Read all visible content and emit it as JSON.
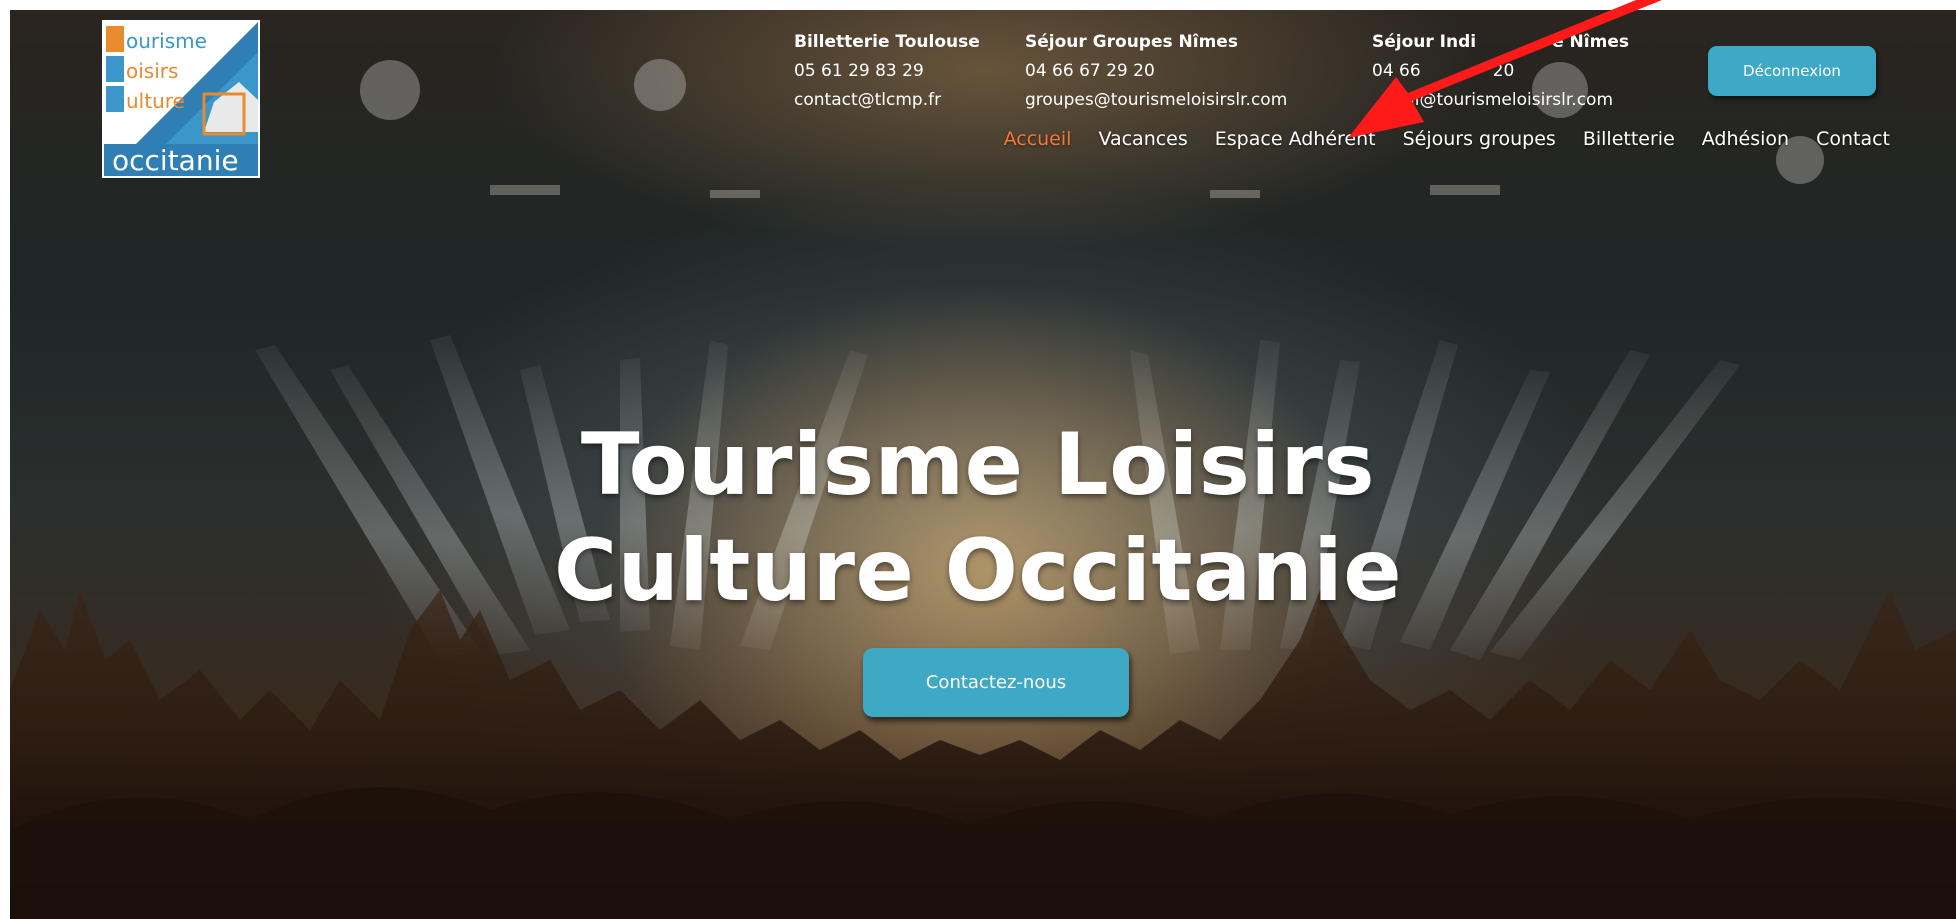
{
  "logo": {
    "line1": "ourisme",
    "line2": "oisirs",
    "line3": "ulture",
    "line4": "occitanie"
  },
  "contacts": [
    {
      "title": "Billetterie Toulouse",
      "phone": "05 61 29 83 29",
      "email": "contact@tlcmp.fr"
    },
    {
      "title": "Séjour Groupes Nîmes",
      "phone": "04 66 67 29 20",
      "email": "groupes@tourismeloisirslr.com"
    },
    {
      "title": "Séjour Indi",
      "title_end": "e Nîmes",
      "phone": "04 66",
      "phone_end": "20",
      "email": "il@tourismeloisirslr.com"
    }
  ],
  "header": {
    "logout_label": "Déconnexion"
  },
  "nav": {
    "items": [
      "Accueil",
      "Vacances",
      "Espace Adhérent",
      "Séjours groupes",
      "Billetterie",
      "Adhésion",
      "Contact"
    ],
    "active": "Accueil"
  },
  "hero": {
    "title_line1": "Tourisme Loisirs",
    "title_line2": "Culture Occitanie",
    "cta_label": "Contactez-nous"
  },
  "colors": {
    "accent": "#3ea9c4",
    "active_nav": "#f07a36",
    "annotation_arrow": "#ff1a1a"
  },
  "icons": {
    "annotation": "red-arrow-icon"
  }
}
